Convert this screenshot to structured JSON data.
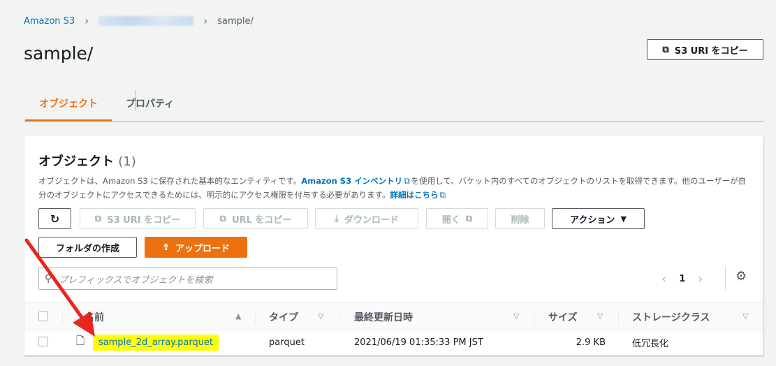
{
  "breadcrumb": {
    "root": "Amazon S3",
    "current": "sample/"
  },
  "page": {
    "title": "sample/"
  },
  "header_actions": {
    "copy_s3_uri": "S3 URI をコピー"
  },
  "tabs": [
    {
      "label": "オブジェクト",
      "active": true
    },
    {
      "label": "プロパティ",
      "active": false
    }
  ],
  "objects_panel": {
    "title": "オブジェクト",
    "count": "(1)",
    "desc_part1": "オブジェクトは、Amazon S3 に保存された基本的なエンティティです。",
    "desc_link1": "Amazon S3 インベントリ",
    "desc_part2": "を使用して、バケット内のすべてのオブジェクトのリストを取得できます。他のユーザーが自分のオブジェクトにアクセスできるためには、明示的にアクセス権限を付与する必要があります。",
    "desc_link2": "詳細はこちら"
  },
  "toolbar": {
    "copy_s3_uri": "S3 URI をコピー",
    "copy_url": "URL をコピー",
    "download": "ダウンロード",
    "open": "開く",
    "delete": "削除",
    "actions": "アクション",
    "create_folder": "フォルダの作成",
    "upload": "アップロード"
  },
  "search": {
    "placeholder": "プレフィックスでオブジェクトを検索"
  },
  "pagination": {
    "current_page": "1"
  },
  "table": {
    "columns": {
      "name": "名前",
      "type": "タイプ",
      "last_modified": "最終更新日時",
      "size": "サイズ",
      "storage_class": "ストレージクラス"
    },
    "rows": [
      {
        "name": "sample_2d_array.parquet",
        "type": "parquet",
        "last_modified": "2021/06/19 01:35:33 PM JST",
        "size": "2.9 KB",
        "storage_class": "低冗長化"
      }
    ]
  },
  "colors": {
    "accent": "#ec7211",
    "link": "#0073bb",
    "highlight": "#ffff00",
    "annotation_arrow": "#e8261d"
  },
  "icons": {
    "breadcrumb_separator": "chevron-right-icon",
    "copy": "copy-icon",
    "refresh": "refresh-icon",
    "download": "download-icon",
    "external": "external-link-icon",
    "upload": "upload-icon",
    "dropdown": "caret-down-icon",
    "search": "search-icon",
    "settings": "gear-icon",
    "file": "file-icon",
    "sort_asc": "sort-ascending-icon",
    "sort": "sort-icon"
  }
}
